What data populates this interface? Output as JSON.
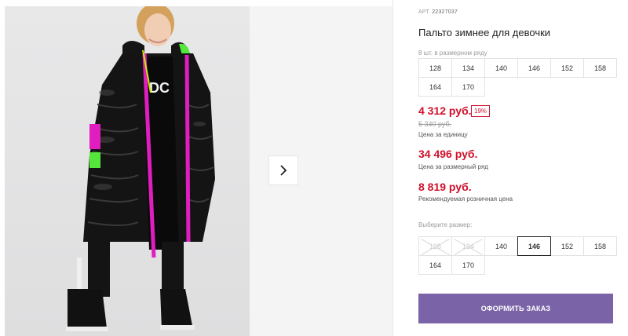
{
  "product": {
    "article_label": "АРТ.",
    "article_number": "22327037",
    "title": "Пальто зимнее для девочки"
  },
  "size_row": {
    "caption": "8 шт. в размерном ряду",
    "sizes": [
      "128",
      "134",
      "140",
      "146",
      "152",
      "158",
      "164",
      "170"
    ]
  },
  "pricing": {
    "unit_price": "4 312 руб.",
    "discount_badge": "19%",
    "old_price": "5 340 руб.",
    "unit_label": "Цена за единицу",
    "row_price": "34 496 руб.",
    "row_label": "Цена за размерный ряд",
    "retail_price": "8 819 руб.",
    "retail_label": "Рекомендуемая розничная цена"
  },
  "size_picker": {
    "label": "Выберите размер:",
    "sizes": [
      "128",
      "134",
      "140",
      "146",
      "152",
      "158",
      "164",
      "170"
    ],
    "unavailable": [
      "128",
      "134"
    ],
    "selected": "146"
  },
  "actions": {
    "order_button": "ОФОРМИТЬ ЗАКАЗ"
  },
  "gallery": {
    "next_icon": "chevron-right-icon"
  },
  "colors": {
    "price_red": "#d0112b",
    "button_purple": "#7a63a7"
  }
}
